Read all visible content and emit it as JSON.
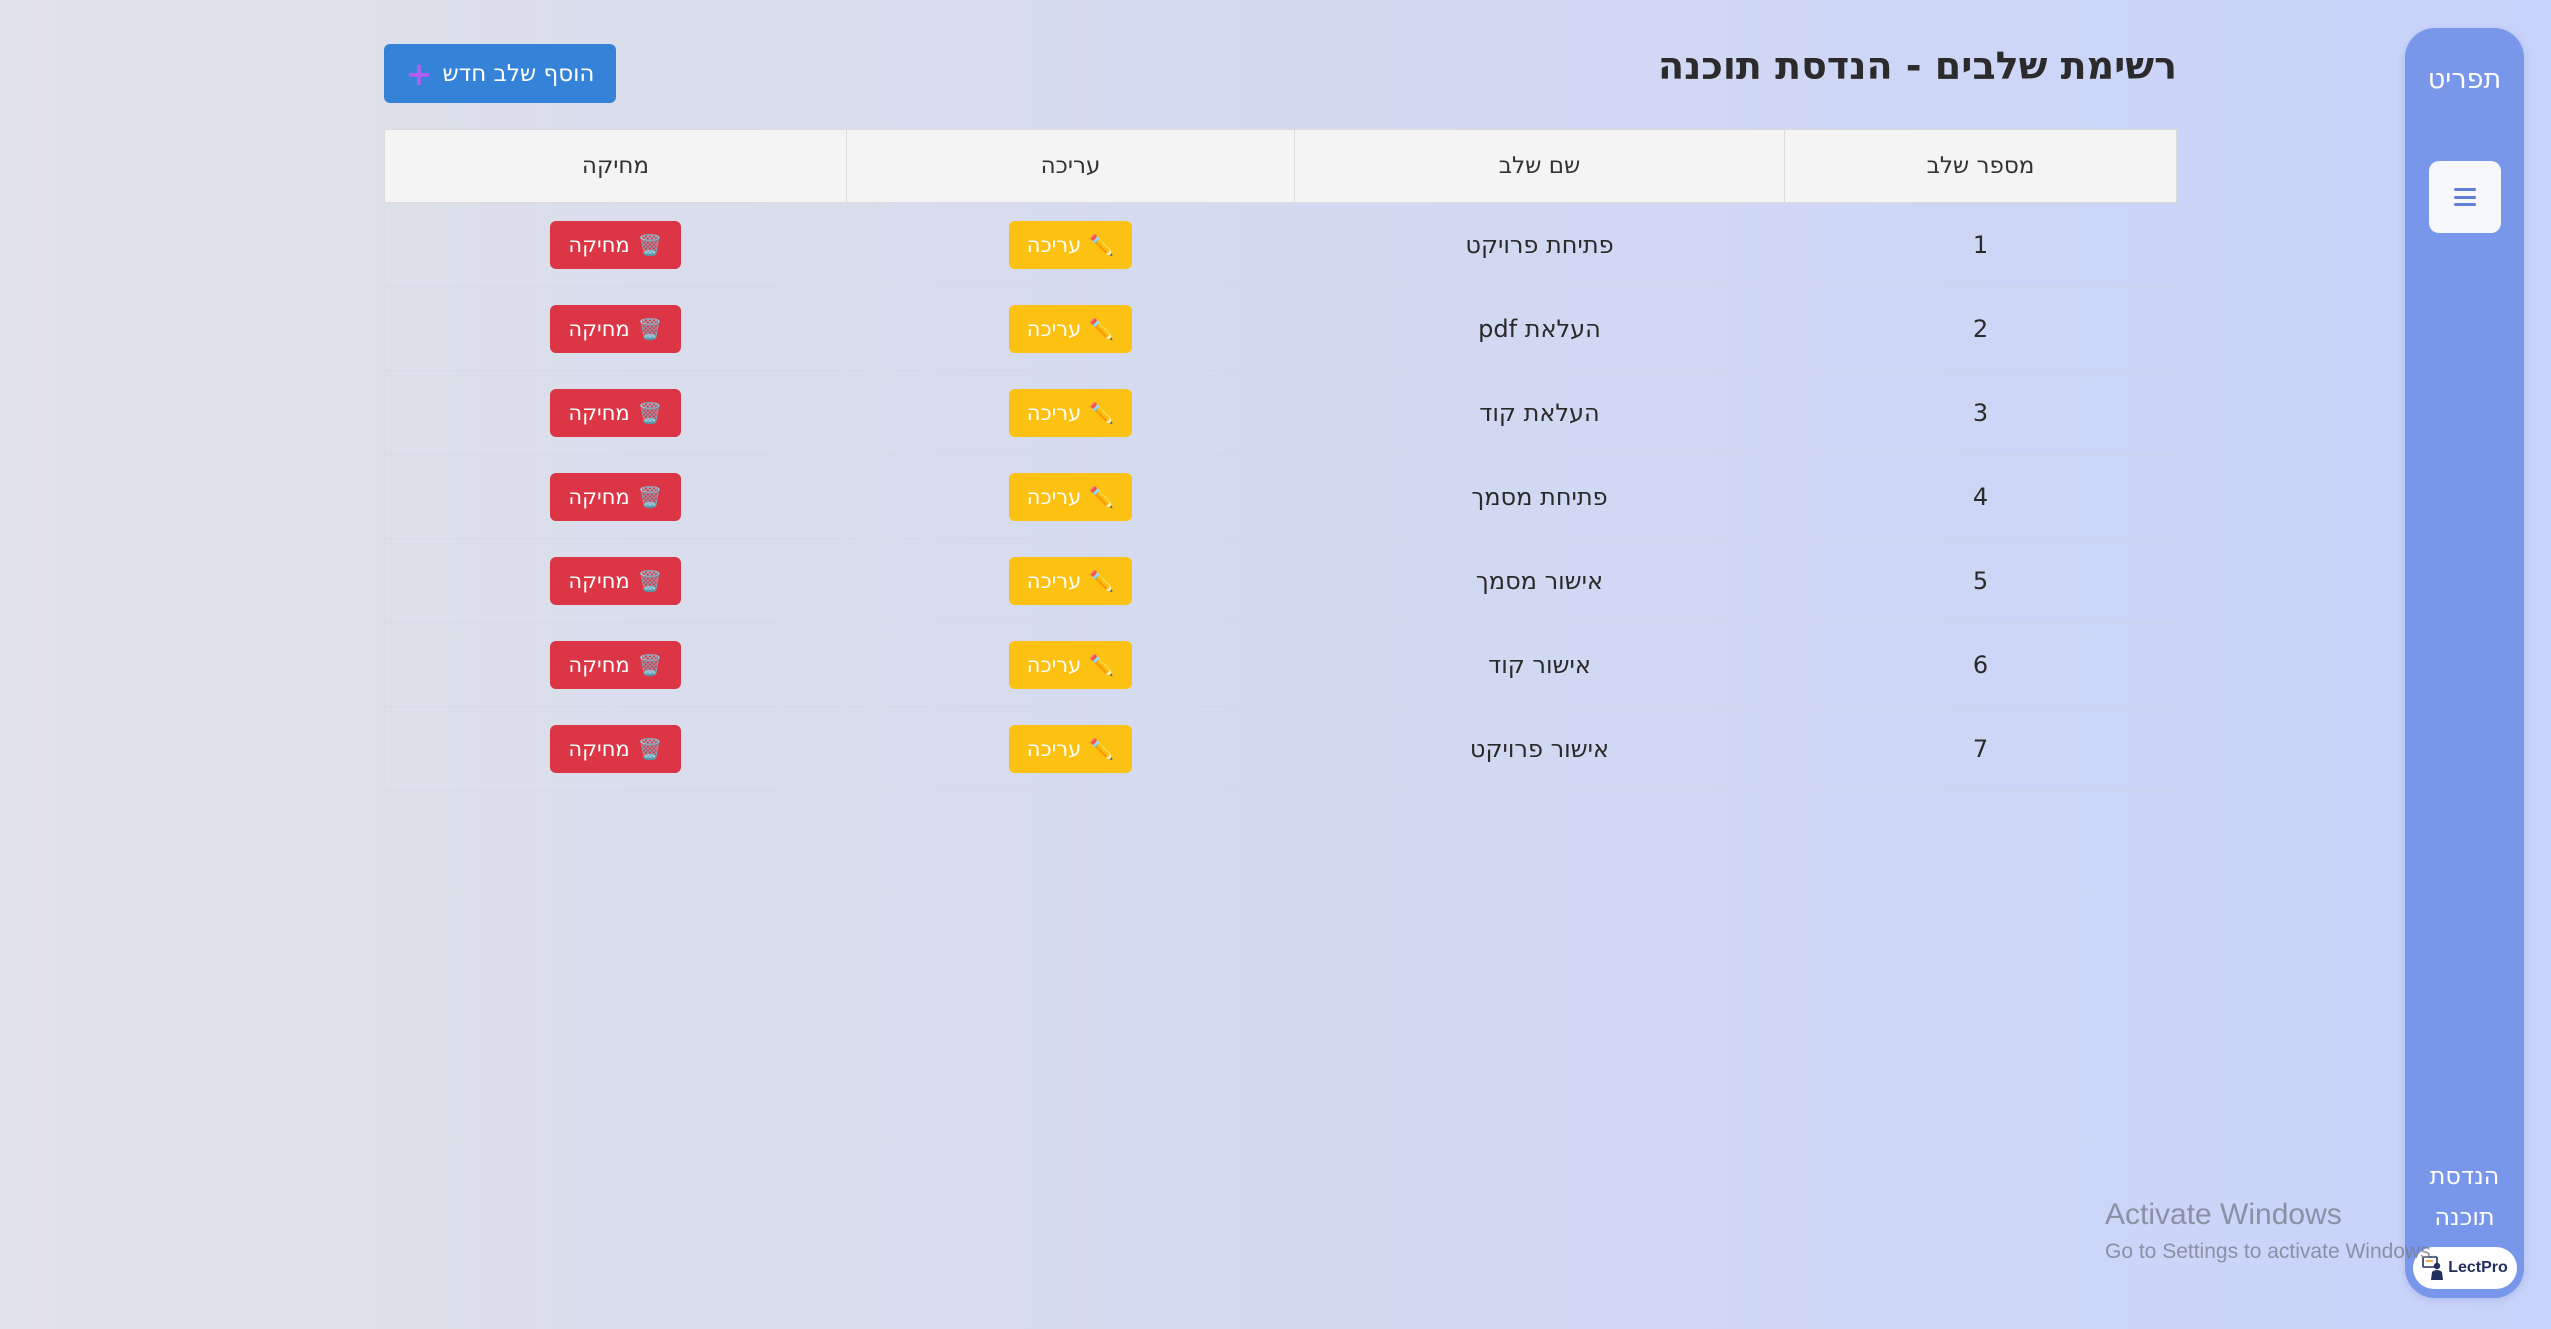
{
  "sidebar": {
    "menu_label": "תפריט",
    "dept_line1": "הנדסת",
    "dept_line2": "תוכנה",
    "brand": "LectPro"
  },
  "header": {
    "title": "רשימת שלבים - הנדסת תוכנה",
    "add_button_label": "הוסף שלב חדש",
    "add_button_icon": "plus-icon"
  },
  "table": {
    "columns": [
      "מספר שלב",
      "שם שלב",
      "עריכה",
      "מחיקה"
    ],
    "edit_label": "עריכה",
    "delete_label": "מחיקה",
    "edit_icon": "pencil-icon",
    "delete_icon": "trash-icon",
    "rows": [
      {
        "num": "1",
        "name": "פתיחת פרויקט"
      },
      {
        "num": "2",
        "name": "העלאת pdf"
      },
      {
        "num": "3",
        "name": "העלאת קוד"
      },
      {
        "num": "4",
        "name": "פתיחת מסמך"
      },
      {
        "num": "5",
        "name": "אישור מסמך"
      },
      {
        "num": "6",
        "name": "אישור קוד"
      },
      {
        "num": "7",
        "name": "אישור פרויקט"
      }
    ]
  },
  "watermark": {
    "title": "Activate Windows",
    "subtitle": "Go to Settings to activate Windows."
  },
  "colors": {
    "sidebar": "#7896ea",
    "primary": "#3583d9",
    "edit": "#fdc111",
    "delete": "#dc3545"
  }
}
